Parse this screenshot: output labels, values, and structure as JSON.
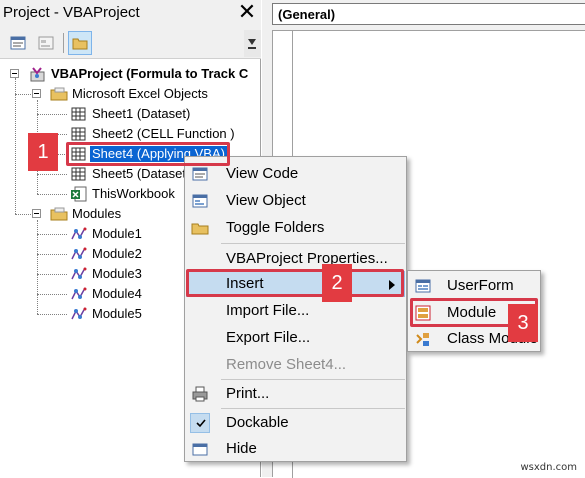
{
  "panel": {
    "title": "Project - VBAProject",
    "close": "✕"
  },
  "tree": {
    "project": "VBAProject (Formula to Track C",
    "excel_objects": "Microsoft Excel Objects",
    "sheets": [
      "Sheet1 (Dataset)",
      "Sheet2 (CELL Function )",
      "Sheet4 (Applying VBA)",
      "Sheet5 (Dataset",
      "ThisWorkbook"
    ],
    "modules_folder": "Modules",
    "modules": [
      "Module1",
      "Module2",
      "Module3",
      "Module4",
      "Module5"
    ]
  },
  "code": {
    "object_dropdown": "(General)"
  },
  "context_menu": {
    "view_code": "View Code",
    "view_object": "View Object",
    "toggle_folders": "Toggle Folders",
    "properties": "VBAProject Properties...",
    "insert": "Insert",
    "import_file": "Import File...",
    "export_file": "Export File...",
    "remove": "Remove Sheet4...",
    "print": "Print...",
    "dockable": "Dockable",
    "hide": "Hide"
  },
  "submenu": {
    "userform": "UserForm",
    "module": "Module",
    "class_module": "Class Module"
  },
  "callouts": [
    "1",
    "2",
    "3"
  ],
  "watermark": "wsxdn.com",
  "colors": {
    "callout_red": "#e23b41",
    "selection_blue": "#0a64d2",
    "menu_highlight": "#c5dcf0"
  }
}
